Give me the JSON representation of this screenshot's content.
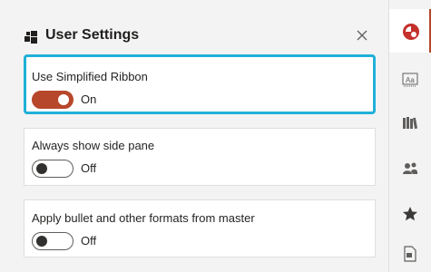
{
  "panel": {
    "title": "User Settings",
    "icon": "settings-pieces-icon",
    "close_icon": "close-icon"
  },
  "settings": [
    {
      "label": "Use Simplified Ribbon",
      "state": "On",
      "enabled": true,
      "selected": true
    },
    {
      "label": "Always show side pane",
      "state": "Off",
      "enabled": false,
      "selected": false
    },
    {
      "label": "Apply bullet and other formats from master",
      "state": "Off",
      "enabled": false,
      "selected": false
    }
  ],
  "rail": {
    "items": [
      {
        "icon": "app-logo-icon",
        "active": true
      },
      {
        "icon": "text-style-icon"
      },
      {
        "icon": "library-icon"
      },
      {
        "icon": "people-icon"
      },
      {
        "icon": "star-icon"
      },
      {
        "icon": "document-icon"
      }
    ]
  },
  "colors": {
    "accent": "#b7472a",
    "focus": "#1fb0d8",
    "background": "#f3f3f3"
  }
}
